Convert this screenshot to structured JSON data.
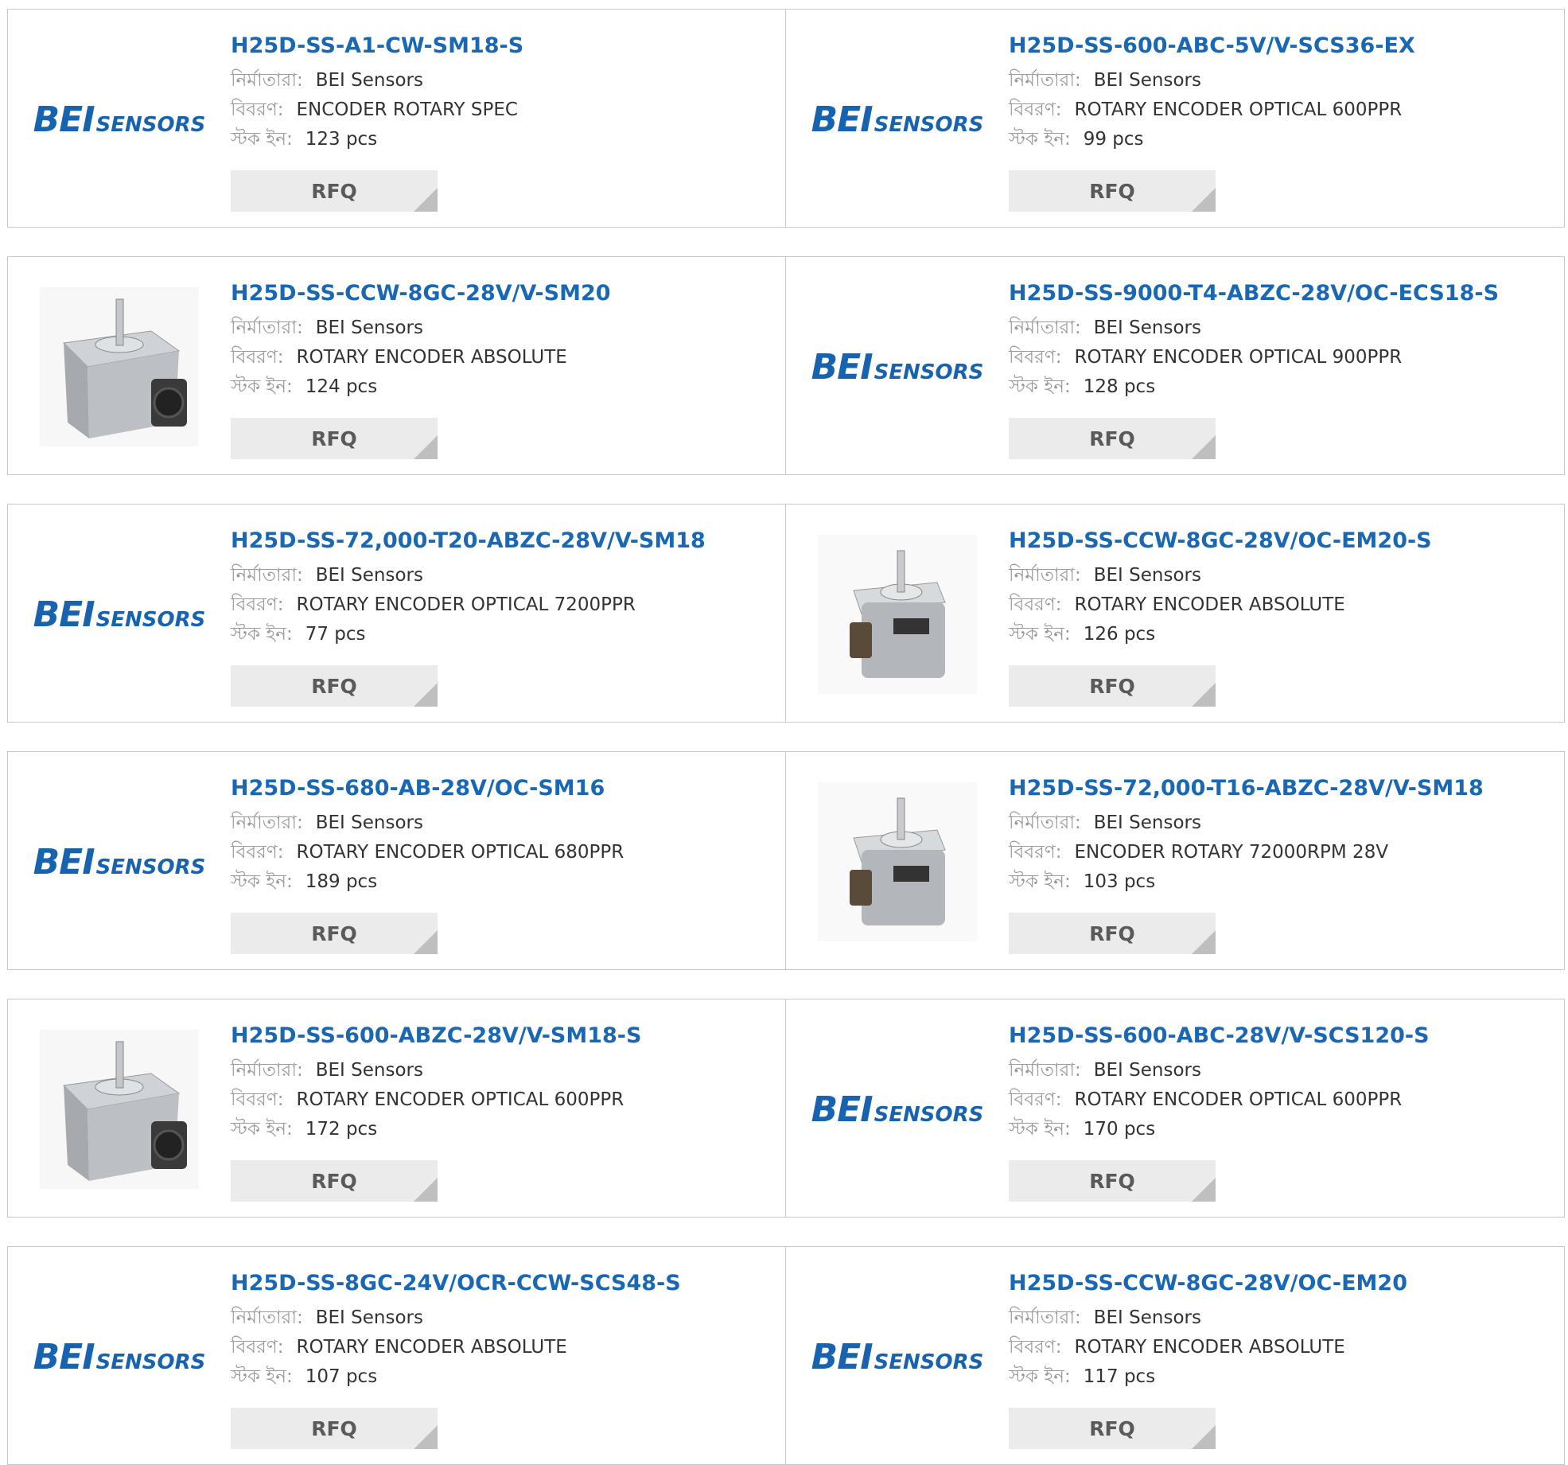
{
  "labels": {
    "manufacturer": "নির্মাতারা:",
    "description": "বিবরণ:",
    "stock": "স্টক ইন:",
    "rfq": "RFQ"
  },
  "logo": {
    "bei": "BEI",
    "sensors": "SENSORS"
  },
  "colors": {
    "title": "#1a68b4",
    "logo": "#1763b0",
    "rfq_bg": "#ebebeb"
  },
  "products": [
    {
      "part": "H25D-SS-A1-CW-SM18-S",
      "manufacturer": "BEI Sensors",
      "description": "ENCODER ROTARY SPEC",
      "stock": "123 pcs",
      "image": "logo"
    },
    {
      "part": "H25D-SS-600-ABC-5V/V-SCS36-EX",
      "manufacturer": "BEI Sensors",
      "description": "ROTARY ENCODER OPTICAL 600PPR",
      "stock": "99 pcs",
      "image": "logo"
    },
    {
      "part": "H25D-SS-CCW-8GC-28V/V-SM20",
      "manufacturer": "BEI Sensors",
      "description": "ROTARY ENCODER ABSOLUTE",
      "stock": "124 pcs",
      "image": "encoder-side"
    },
    {
      "part": "H25D-SS-9000-T4-ABZC-28V/OC-ECS18-S",
      "manufacturer": "BEI Sensors",
      "description": "ROTARY ENCODER OPTICAL 900PPR",
      "stock": "128 pcs",
      "image": "logo"
    },
    {
      "part": "H25D-SS-72,000-T20-ABZC-28V/V-SM18",
      "manufacturer": "BEI Sensors",
      "description": "ROTARY ENCODER OPTICAL 7200PPR",
      "stock": "77 pcs",
      "image": "logo"
    },
    {
      "part": "H25D-SS-CCW-8GC-28V/OC-EM20-S",
      "manufacturer": "BEI Sensors",
      "description": "ROTARY ENCODER ABSOLUTE",
      "stock": "126 pcs",
      "image": "encoder-front"
    },
    {
      "part": "H25D-SS-680-AB-28V/OC-SM16",
      "manufacturer": "BEI Sensors",
      "description": "ROTARY ENCODER OPTICAL 680PPR",
      "stock": "189 pcs",
      "image": "logo"
    },
    {
      "part": "H25D-SS-72,000-T16-ABZC-28V/V-SM18",
      "manufacturer": "BEI Sensors",
      "description": "ENCODER ROTARY 72000RPM 28V",
      "stock": "103 pcs",
      "image": "encoder-front"
    },
    {
      "part": "H25D-SS-600-ABZC-28V/V-SM18-S",
      "manufacturer": "BEI Sensors",
      "description": "ROTARY ENCODER OPTICAL 600PPR",
      "stock": "172 pcs",
      "image": "encoder-side"
    },
    {
      "part": "H25D-SS-600-ABC-28V/V-SCS120-S",
      "manufacturer": "BEI Sensors",
      "description": "ROTARY ENCODER OPTICAL 600PPR",
      "stock": "170 pcs",
      "image": "logo"
    },
    {
      "part": "H25D-SS-8GC-24V/OCR-CCW-SCS48-S",
      "manufacturer": "BEI Sensors",
      "description": "ROTARY ENCODER ABSOLUTE",
      "stock": "107 pcs",
      "image": "logo"
    },
    {
      "part": "H25D-SS-CCW-8GC-28V/OC-EM20",
      "manufacturer": "BEI Sensors",
      "description": "ROTARY ENCODER ABSOLUTE",
      "stock": "117 pcs",
      "image": "logo"
    }
  ]
}
